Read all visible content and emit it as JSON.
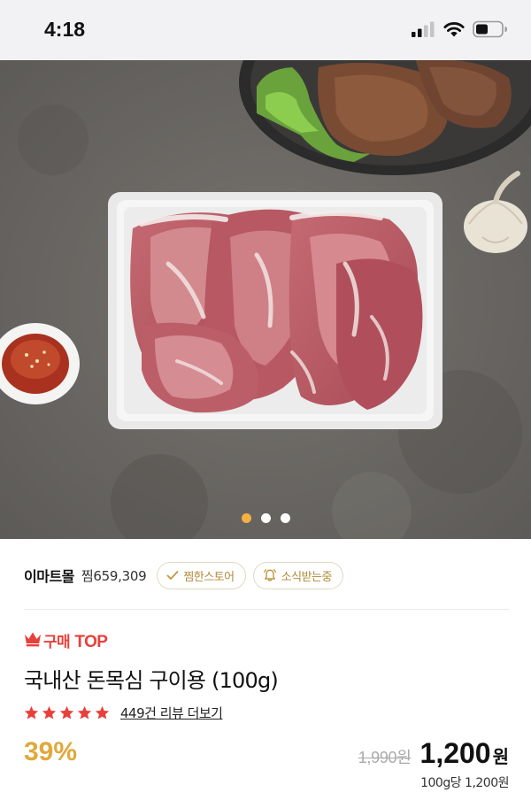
{
  "status_bar": {
    "time": "4:18",
    "icons": [
      "cellular-signal-icon",
      "wifi-icon",
      "battery-icon"
    ]
  },
  "hero": {
    "image": "raw pork neck cuts on a white tray, grilled pork on dark plate, garlic bulb and dipping sauce",
    "slide_count": 3,
    "active_slide": 1,
    "indicator_active_color": "#f5b042"
  },
  "store": {
    "name": "이마트몰",
    "wishlist_count": "찜659,309",
    "favorite_chip_label": "찜한스토어",
    "notify_chip_label": "소식받는중",
    "chip_text_color": "#b28a3a"
  },
  "product": {
    "badge_prefix": "구매",
    "badge_top": "TOP",
    "badge_color": "#e8403a",
    "title": "국내산 돈목심 구이용 (100g)",
    "rating_stars": 5,
    "star_color": "#e8403a",
    "review_link": "449건 리뷰 더보기",
    "discount": "39%",
    "discount_color": "#e0a93c",
    "original_price": "1,990원",
    "sale_price": "1,200",
    "currency": "원",
    "unit_price": "100g당 1,200원"
  }
}
